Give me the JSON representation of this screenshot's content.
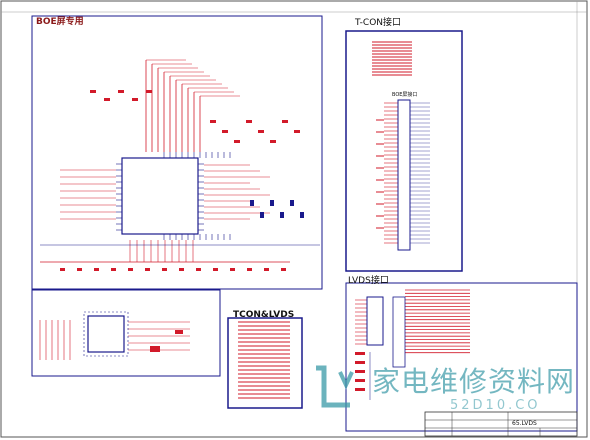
{
  "sections": {
    "boe": {
      "title": "BOE屏专用"
    },
    "tcon_connector": {
      "title": "T-CON接口"
    },
    "boe_connector": {
      "title": "BOE屏接口"
    },
    "lvds_connector": {
      "title": "LVDS接口"
    },
    "tcon_lvds": {
      "title": "TCON&LVDS"
    }
  },
  "title_block": {
    "sheet_name": "65.LVDS"
  },
  "watermark": {
    "text": "家电维修资料网",
    "url": "52D10.CO"
  },
  "colors": {
    "frame": "#1a1a8c",
    "wire": "#d21a2a",
    "ink": "#1a1a8c",
    "watermark": "#3a9aa8"
  }
}
